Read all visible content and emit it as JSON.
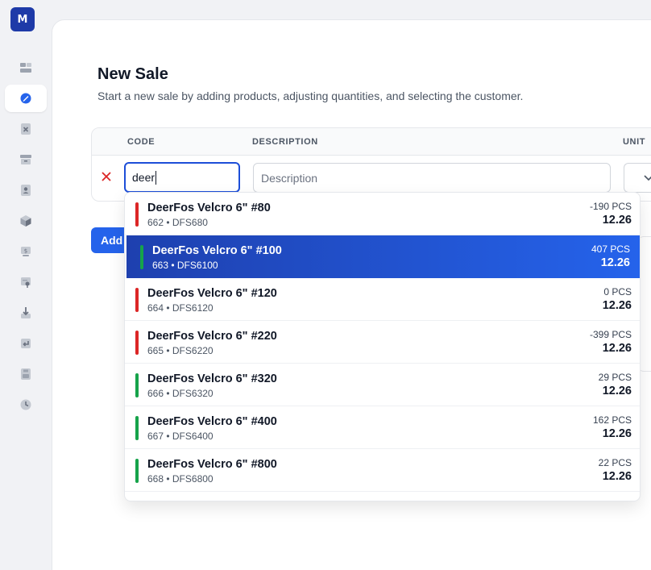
{
  "app": {
    "logo_letter": "M"
  },
  "sidebar": {
    "items": [
      {
        "icon": "dashboard-icon"
      },
      {
        "icon": "new-sale-icon",
        "active": true
      },
      {
        "icon": "void-icon"
      },
      {
        "icon": "inventory-icon"
      },
      {
        "icon": "customers-icon"
      },
      {
        "icon": "products-icon"
      },
      {
        "icon": "pricing-icon"
      },
      {
        "icon": "reports-icon"
      },
      {
        "icon": "receiving-icon"
      },
      {
        "icon": "returns-icon"
      },
      {
        "icon": "storage-icon"
      },
      {
        "icon": "history-icon"
      }
    ]
  },
  "page": {
    "title": "New Sale",
    "subtitle": "Start a new sale by adding products, adjusting quantities, and selecting the customer."
  },
  "table": {
    "headers": {
      "code": "CODE",
      "description": "DESCRIPTION",
      "unit": "UNIT"
    },
    "row": {
      "code_value": "deer",
      "description_placeholder": "Description"
    }
  },
  "add_button_label": "Add",
  "dropdown": {
    "options": [
      {
        "name": "DeerFos Velcro 6\" #80",
        "meta": "662 • DFS680",
        "qty": "-190 PCS",
        "price": "12.26",
        "in_stock": false,
        "selected": false
      },
      {
        "name": "DeerFos Velcro 6\" #100",
        "meta": "663 • DFS6100",
        "qty": "407 PCS",
        "price": "12.26",
        "in_stock": true,
        "selected": true
      },
      {
        "name": "DeerFos Velcro 6\" #120",
        "meta": "664 • DFS6120",
        "qty": "0 PCS",
        "price": "12.26",
        "in_stock": false,
        "selected": false
      },
      {
        "name": "DeerFos Velcro 6\" #220",
        "meta": "665 • DFS6220",
        "qty": "-399 PCS",
        "price": "12.26",
        "in_stock": false,
        "selected": false
      },
      {
        "name": "DeerFos Velcro 6\" #320",
        "meta": "666 • DFS6320",
        "qty": "29 PCS",
        "price": "12.26",
        "in_stock": true,
        "selected": false
      },
      {
        "name": "DeerFos Velcro 6\" #400",
        "meta": "667 • DFS6400",
        "qty": "162 PCS",
        "price": "12.26",
        "in_stock": true,
        "selected": false
      },
      {
        "name": "DeerFos Velcro 6\" #800",
        "meta": "668 • DFS6800",
        "qty": "22 PCS",
        "price": "12.26",
        "in_stock": true,
        "selected": false
      }
    ]
  },
  "colors": {
    "in_stock": "#16a34a",
    "out_of_stock": "#dc2626",
    "accent": "#1d4ed8",
    "remove": "#dc2626"
  }
}
